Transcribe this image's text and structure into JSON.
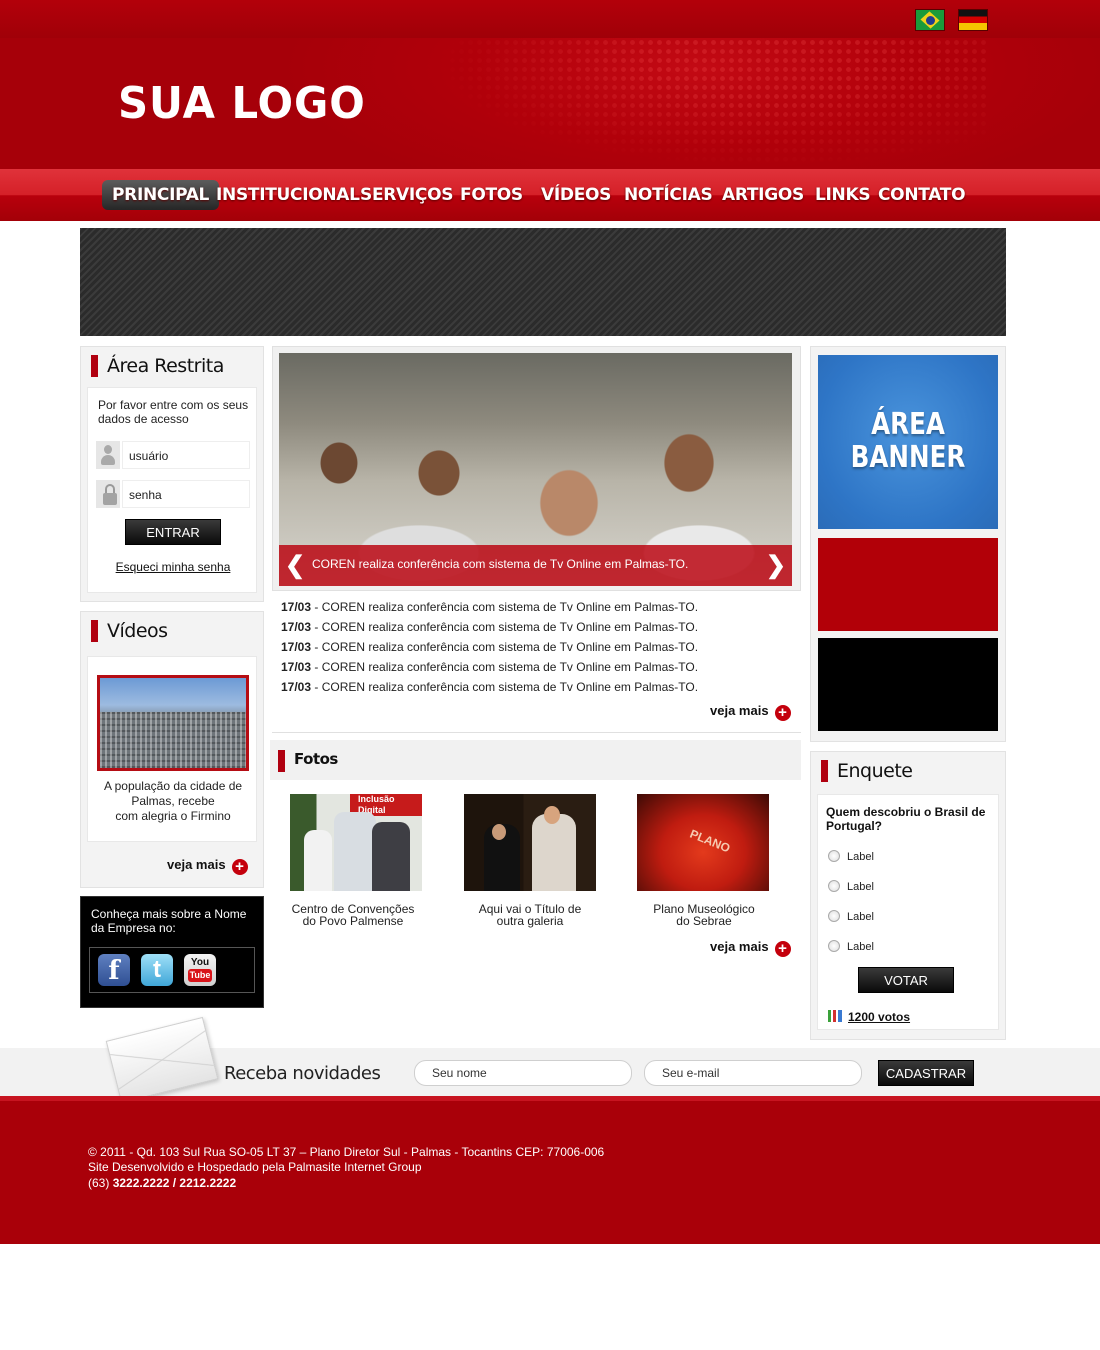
{
  "header": {
    "logo_text": "SUA LOGO",
    "languages": [
      "Português (Brasil)",
      "Deutsch"
    ]
  },
  "nav": {
    "items": [
      "PRINCIPAL",
      "INSTITUCIONAL",
      "SERVIÇOS",
      "FOTOS",
      "VÍDEOS",
      "NOTÍCIAS",
      "ARTIGOS",
      "LINKS",
      "CONTATO"
    ],
    "active": "PRINCIPAL"
  },
  "login": {
    "title": "Área Restrita",
    "message": "Por favor entre com os seus dados de acesso",
    "user_placeholder": "usuário",
    "pass_placeholder": "senha",
    "submit": "ENTRAR",
    "forgot": "Esqueci minha senha"
  },
  "videos": {
    "title": "Vídeos",
    "caption_lines": [
      "A população da cidade de",
      "Palmas, recebe",
      "com alegria o Firmino"
    ],
    "more": "veja mais"
  },
  "social": {
    "text": "Conheça mais sobre a Nome da Empresa no:",
    "networks": [
      "facebook",
      "twitter",
      "youtube"
    ],
    "youtube_you": "You",
    "youtube_tube": "Tube"
  },
  "slider": {
    "caption": "COREN realiza conferência com sistema de Tv Online em Palmas-TO.",
    "prev": "❮",
    "next": "❯"
  },
  "news": {
    "items": [
      {
        "date": "17/03",
        "text": " - COREN realiza conferência com sistema de Tv Online em Palmas-TO."
      },
      {
        "date": "17/03",
        "text": " - COREN realiza conferência com sistema de Tv Online em Palmas-TO."
      },
      {
        "date": "17/03",
        "text": " - COREN realiza conferência com sistema de Tv Online em Palmas-TO."
      },
      {
        "date": "17/03",
        "text": " - COREN realiza conferência com sistema de Tv Online em Palmas-TO."
      },
      {
        "date": "17/03",
        "text": " - COREN realiza conferência com sistema de Tv Online em Palmas-TO."
      }
    ],
    "more": "veja mais"
  },
  "fotos": {
    "title": "Fotos",
    "galleries": [
      {
        "caption_1": "Centro de Convenções",
        "caption_2": "do Povo Palmense",
        "sign": "Inclusão Digital"
      },
      {
        "caption_1": "Aqui vai o Título de",
        "caption_2": "outra galeria"
      },
      {
        "caption_1": "Plano Museológico",
        "caption_2": "do Sebrae",
        "inscription": "PLANO"
      }
    ],
    "more": "veja mais"
  },
  "banners": {
    "area_line1": "ÁREA",
    "area_line2": "BANNER"
  },
  "poll": {
    "title": "Enquete",
    "question": "Quem descobriu o Brasil de Portugal?",
    "options": [
      "Label",
      "Label",
      "Label",
      "Label"
    ],
    "submit": "VOTAR",
    "votes": "1200 votos"
  },
  "newsletter": {
    "label": "Receba novidades",
    "name_placeholder": "Seu nome",
    "email_placeholder": "Seu e-mail",
    "submit": "CADASTRAR"
  },
  "footer": {
    "address": "© 2011 - Qd. 103 Sul Rua SO-05 LT 37 – Plano Diretor Sul - Palmas - Tocantins  CEP: 77006-006",
    "credits": "Site Desenvolvido e Hospedado pela Palmasite Internet Group",
    "area_code": "(63) ",
    "phones": "3222.2222  /  2212.2222"
  },
  "colors": {
    "brand_red": "#b00010",
    "footer_red": "#a90009",
    "banner_blue": "#2e75c6"
  }
}
